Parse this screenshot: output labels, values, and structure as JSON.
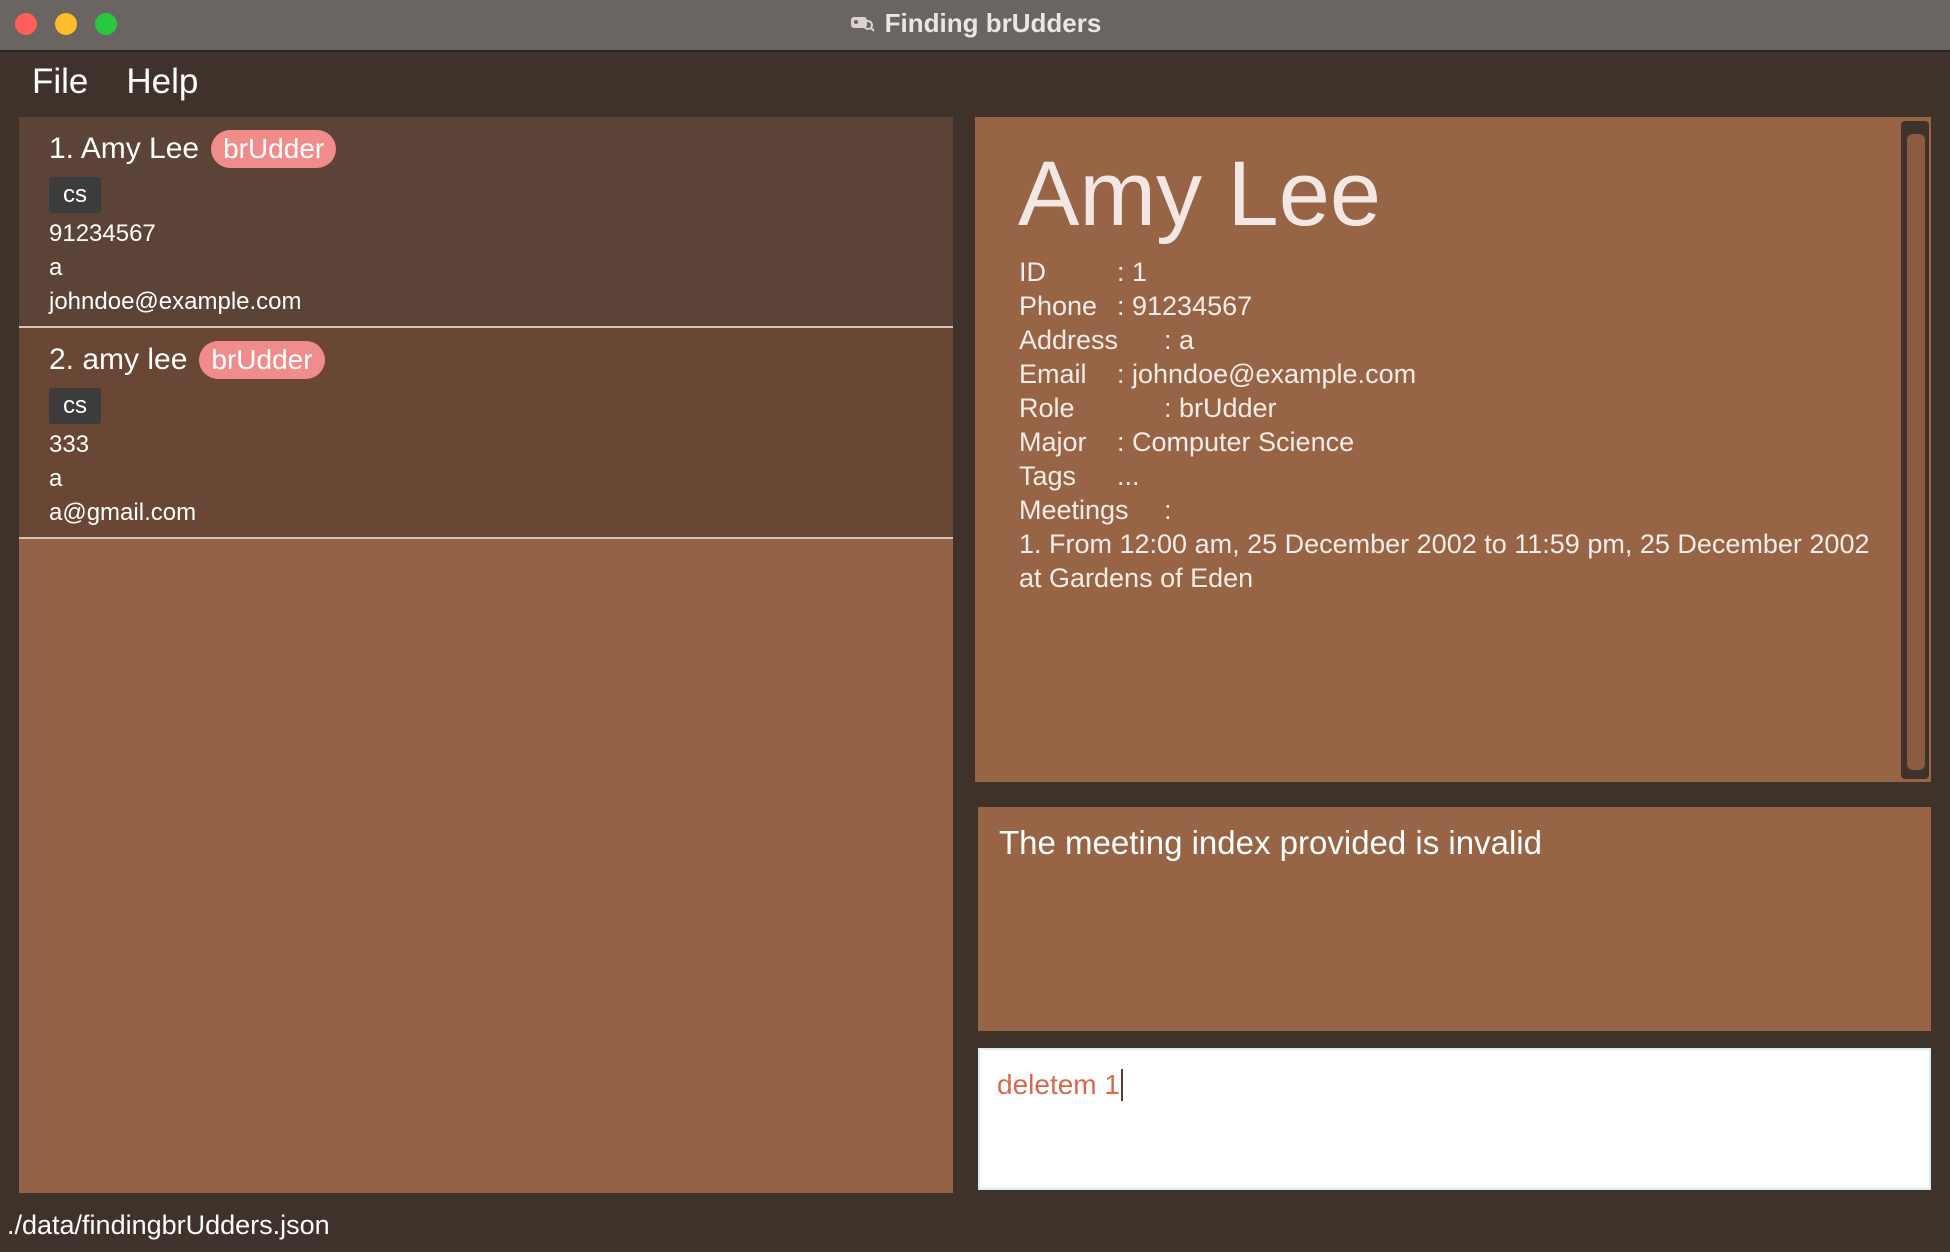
{
  "window": {
    "title": "Finding brUdders"
  },
  "menu": {
    "file": "File",
    "help": "Help"
  },
  "persons": [
    {
      "name": "1. Amy Lee",
      "role": "brUdder",
      "tag": "cs",
      "phone": "91234567",
      "address": "a",
      "email": "johndoe@example.com"
    },
    {
      "name": "2. amy lee",
      "role": "brUdder",
      "tag": "cs",
      "phone": "333",
      "address": "a",
      "email": "a@gmail.com"
    }
  ],
  "detail": {
    "name": "Amy Lee",
    "fields": [
      {
        "label": "ID",
        "value": ": 1"
      },
      {
        "label": "Phone",
        "value": ": 91234567"
      },
      {
        "label": "Address",
        "value": ": a"
      },
      {
        "label": "Email",
        "value": ": johndoe@example.com"
      },
      {
        "label": "Role",
        "value": ": brUdder"
      },
      {
        "label": "Major",
        "value": ": Computer Science"
      },
      {
        "label": "Tags",
        "value": "..."
      },
      {
        "label": "Meetings",
        "value": ":"
      }
    ],
    "meetings": [
      "1. From 12:00 am, 25 December 2002 to 11:59 pm, 25 December 2002",
      "at Gardens of Eden"
    ]
  },
  "result": {
    "message": "The meeting index provided is invalid"
  },
  "command": {
    "value": "deletem 1"
  },
  "status": {
    "path": "./data/findingbrUdders.json"
  },
  "colors": {
    "window_bg": "#3f322b",
    "list_bg": "#936146",
    "card_odd": "#5c4337",
    "card_even": "#6a4634",
    "badge_role": "#f08c8c",
    "badge_tag": "#3c3c3c",
    "detail_bg": "#986446",
    "command_text": "#d8694e"
  }
}
